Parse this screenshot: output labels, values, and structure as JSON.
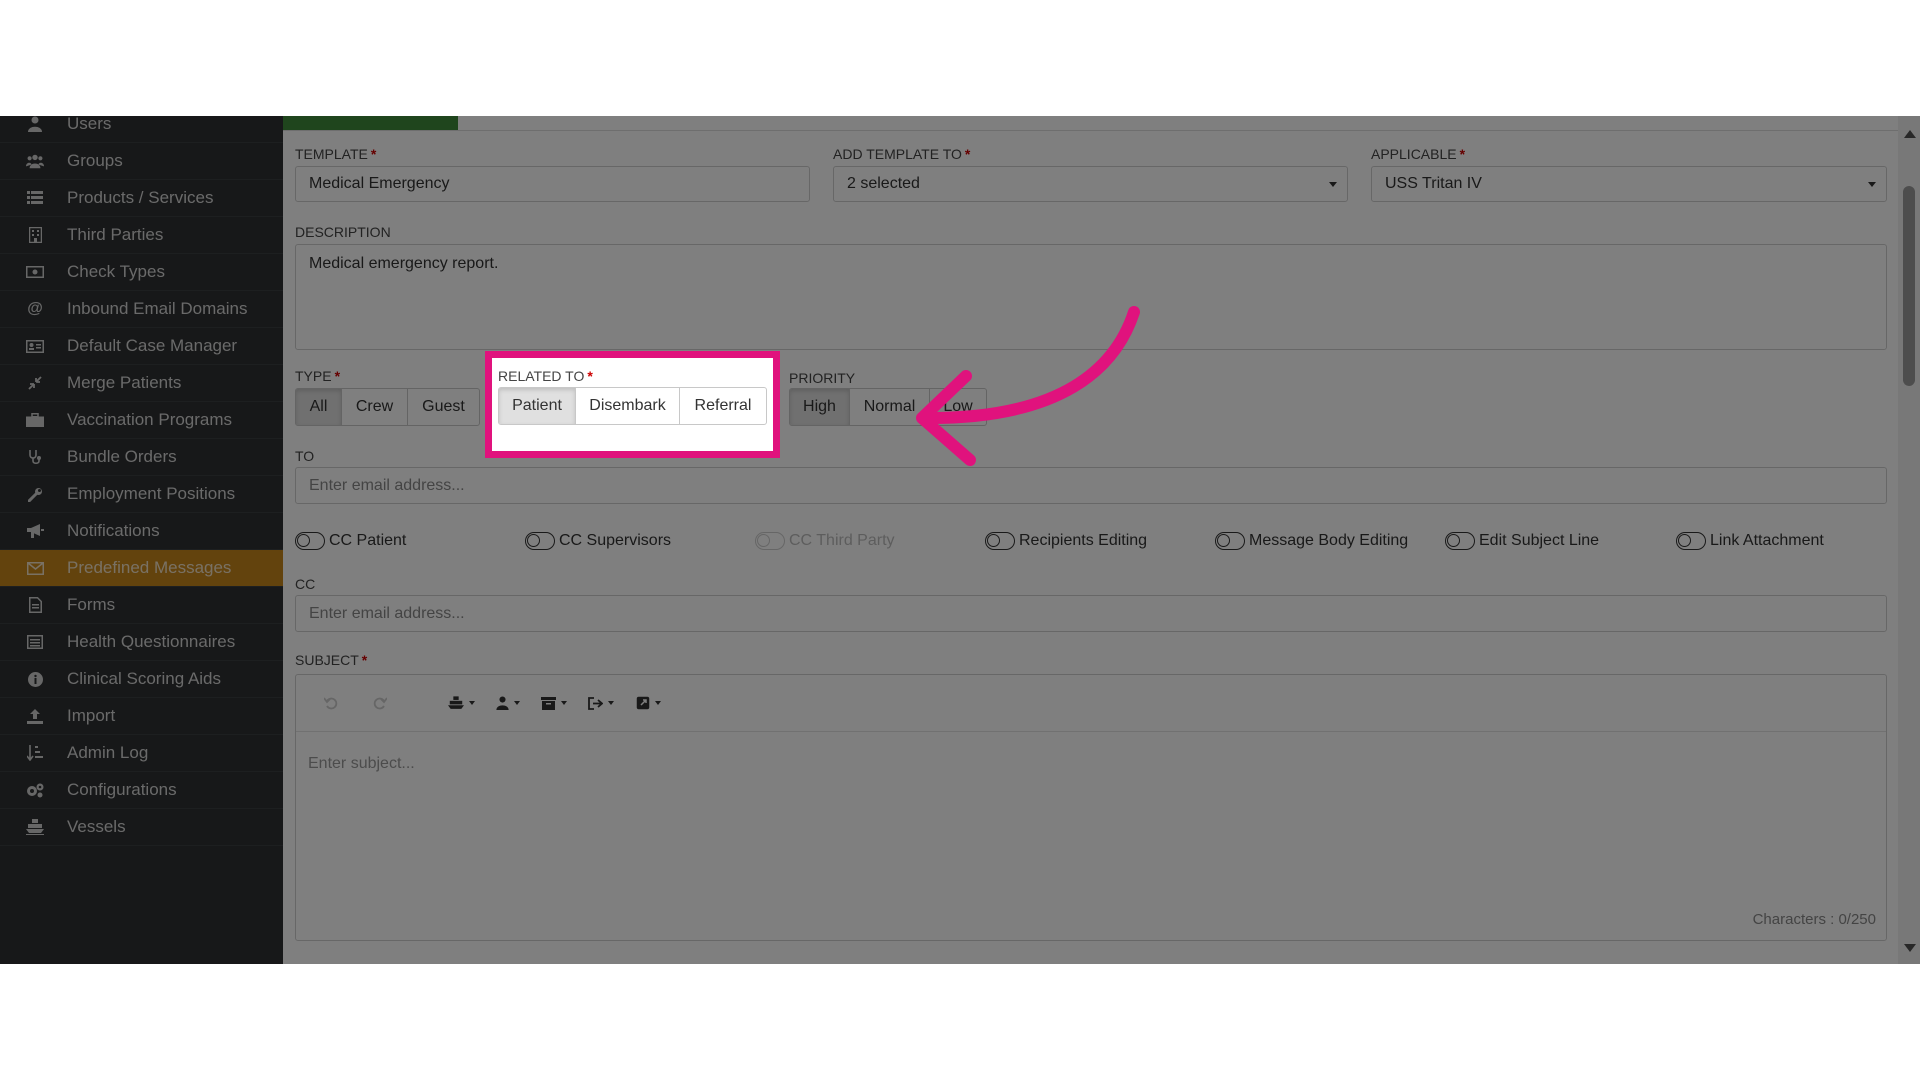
{
  "sidebar": {
    "items": [
      {
        "label": "Users",
        "icon": "user-icon",
        "active": false
      },
      {
        "label": "Groups",
        "icon": "users-icon",
        "active": false
      },
      {
        "label": "Products / Services",
        "icon": "list-icon",
        "active": false
      },
      {
        "label": "Third Parties",
        "icon": "building-icon",
        "active": false
      },
      {
        "label": "Check Types",
        "icon": "money-icon",
        "active": false
      },
      {
        "label": "Inbound Email Domains",
        "icon": "at-icon",
        "active": false
      },
      {
        "label": "Default Case Manager",
        "icon": "id-card-icon",
        "active": false
      },
      {
        "label": "Merge Patients",
        "icon": "compress-icon",
        "active": false
      },
      {
        "label": "Vaccination Programs",
        "icon": "briefcase-icon",
        "active": false
      },
      {
        "label": "Bundle Orders",
        "icon": "stethoscope-icon",
        "active": false
      },
      {
        "label": "Employment Positions",
        "icon": "wrench-icon",
        "active": false
      },
      {
        "label": "Notifications",
        "icon": "bullhorn-icon",
        "active": false
      },
      {
        "label": "Predefined Messages",
        "icon": "envelope-icon",
        "active": true
      },
      {
        "label": "Forms",
        "icon": "file-icon",
        "active": false
      },
      {
        "label": "Health Questionnaires",
        "icon": "list-alt-icon",
        "active": false
      },
      {
        "label": "Clinical Scoring Aids",
        "icon": "info-icon",
        "active": false
      },
      {
        "label": "Import",
        "icon": "upload-icon",
        "active": false
      },
      {
        "label": "Admin Log",
        "icon": "sort-icon",
        "active": false
      },
      {
        "label": "Configurations",
        "icon": "cogs-icon",
        "active": false
      },
      {
        "label": "Vessels",
        "icon": "ship-icon",
        "active": false
      }
    ]
  },
  "form": {
    "template": {
      "label": "TEMPLATE",
      "value": "Medical Emergency"
    },
    "add_template_to": {
      "label": "ADD TEMPLATE TO",
      "value": "2 selected"
    },
    "applicable": {
      "label": "APPLICABLE",
      "value": "USS Tritan IV"
    },
    "description": {
      "label": "DESCRIPTION",
      "value": "Medical emergency report."
    },
    "type": {
      "label": "TYPE",
      "options": [
        "All",
        "Crew",
        "Guest"
      ],
      "selected": "All"
    },
    "related_to": {
      "label": "RELATED TO",
      "options": [
        "Patient",
        "Disembark",
        "Referral"
      ],
      "selected": "Patient"
    },
    "priority": {
      "label": "PRIORITY",
      "options": [
        "High",
        "Normal",
        "Low"
      ],
      "selected": "High"
    },
    "to": {
      "label": "TO",
      "placeholder": "Enter email address..."
    },
    "toggles": [
      "CC Patient",
      "CC Supervisors",
      "CC Third Party",
      "Recipients Editing",
      "Message Body Editing",
      "Edit Subject Line",
      "Link Attachment"
    ],
    "cc": {
      "label": "CC",
      "placeholder": "Enter email address..."
    },
    "subject": {
      "label": "SUBJECT",
      "placeholder": "Enter subject...",
      "counter": "Characters : 0/250"
    }
  },
  "colors": {
    "highlight": "#e0127d",
    "active_nav": "#c7861a",
    "sidebar_bg": "#2f3132"
  }
}
